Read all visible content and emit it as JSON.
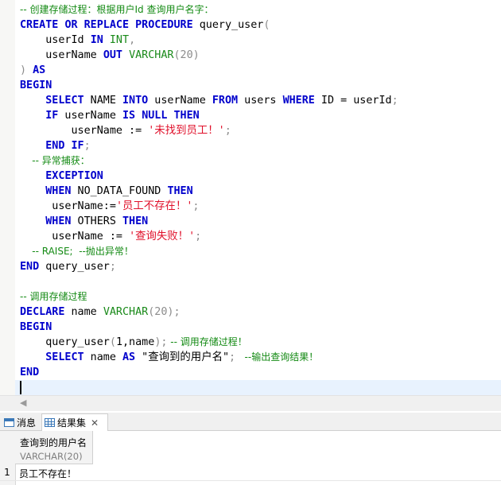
{
  "editor": {
    "lines": [
      [
        {
          "t": "-- 创建存储过程：根据用户Id 查询用户名字：",
          "c": "c"
        }
      ],
      [
        {
          "t": "CREATE",
          "c": "k"
        },
        {
          "t": " ",
          "c": "i"
        },
        {
          "t": "OR",
          "c": "k"
        },
        {
          "t": " ",
          "c": "i"
        },
        {
          "t": "REPLACE",
          "c": "k"
        },
        {
          "t": " ",
          "c": "i"
        },
        {
          "t": "PROCEDURE",
          "c": "k"
        },
        {
          "t": " query_user",
          "c": "i"
        },
        {
          "t": "(",
          "c": "p"
        }
      ],
      [
        {
          "t": "    userId ",
          "c": "i"
        },
        {
          "t": "IN",
          "c": "k"
        },
        {
          "t": " ",
          "c": "i"
        },
        {
          "t": "INT",
          "c": "t"
        },
        {
          "t": ",",
          "c": "p"
        }
      ],
      [
        {
          "t": "    userName ",
          "c": "i"
        },
        {
          "t": "OUT",
          "c": "k"
        },
        {
          "t": " ",
          "c": "i"
        },
        {
          "t": "VARCHAR",
          "c": "t"
        },
        {
          "t": "(20)",
          "c": "p"
        }
      ],
      [
        {
          "t": ")",
          "c": "p"
        },
        {
          "t": " ",
          "c": "i"
        },
        {
          "t": "AS",
          "c": "k"
        }
      ],
      [
        {
          "t": "BEGIN",
          "c": "k"
        }
      ],
      [
        {
          "t": "    ",
          "c": "i"
        },
        {
          "t": "SELECT",
          "c": "k"
        },
        {
          "t": " NAME ",
          "c": "i"
        },
        {
          "t": "INTO",
          "c": "k"
        },
        {
          "t": " userName ",
          "c": "i"
        },
        {
          "t": "FROM",
          "c": "k"
        },
        {
          "t": " users ",
          "c": "i"
        },
        {
          "t": "WHERE",
          "c": "k"
        },
        {
          "t": " ID = userId",
          "c": "i"
        },
        {
          "t": ";",
          "c": "p"
        }
      ],
      [
        {
          "t": "    ",
          "c": "i"
        },
        {
          "t": "IF",
          "c": "k"
        },
        {
          "t": " userName ",
          "c": "i"
        },
        {
          "t": "IS",
          "c": "k"
        },
        {
          "t": " ",
          "c": "i"
        },
        {
          "t": "NULL",
          "c": "k"
        },
        {
          "t": " ",
          "c": "i"
        },
        {
          "t": "THEN",
          "c": "k"
        }
      ],
      [
        {
          "t": "        userName := ",
          "c": "i"
        },
        {
          "t": "'未找到员工！'",
          "c": "s"
        },
        {
          "t": ";",
          "c": "p"
        }
      ],
      [
        {
          "t": "    ",
          "c": "i"
        },
        {
          "t": "END",
          "c": "k"
        },
        {
          "t": " ",
          "c": "i"
        },
        {
          "t": "IF",
          "c": "k"
        },
        {
          "t": ";",
          "c": "p"
        }
      ],
      [
        {
          "t": "    -- 异常捕获：",
          "c": "c"
        }
      ],
      [
        {
          "t": "    ",
          "c": "i"
        },
        {
          "t": "EXCEPTION",
          "c": "k"
        }
      ],
      [
        {
          "t": "    ",
          "c": "i"
        },
        {
          "t": "WHEN",
          "c": "k"
        },
        {
          "t": " NO_DATA_FOUND ",
          "c": "i"
        },
        {
          "t": "THEN",
          "c": "k"
        }
      ],
      [
        {
          "t": "     userName:=",
          "c": "i"
        },
        {
          "t": "'员工不存在！'",
          "c": "s"
        },
        {
          "t": ";",
          "c": "p"
        }
      ],
      [
        {
          "t": "    ",
          "c": "i"
        },
        {
          "t": "WHEN",
          "c": "k"
        },
        {
          "t": " OTHERS ",
          "c": "i"
        },
        {
          "t": "THEN",
          "c": "k"
        }
      ],
      [
        {
          "t": "     userName := ",
          "c": "i"
        },
        {
          "t": "'查询失败！'",
          "c": "s"
        },
        {
          "t": ";",
          "c": "p"
        }
      ],
      [
        {
          "t": "    -- RAISE;  --抛出异常！",
          "c": "c"
        }
      ],
      [
        {
          "t": "END",
          "c": "k"
        },
        {
          "t": " query_user",
          "c": "i"
        },
        {
          "t": ";",
          "c": "p"
        }
      ],
      [],
      [
        {
          "t": "-- 调用存储过程",
          "c": "c"
        }
      ],
      [
        {
          "t": "DECLARE",
          "c": "k"
        },
        {
          "t": " name ",
          "c": "i"
        },
        {
          "t": "VARCHAR",
          "c": "t"
        },
        {
          "t": "(20);",
          "c": "p"
        }
      ],
      [
        {
          "t": "BEGIN",
          "c": "k"
        }
      ],
      [
        {
          "t": "    query_user",
          "c": "i"
        },
        {
          "t": "(",
          "c": "p"
        },
        {
          "t": "1,name",
          "c": "i"
        },
        {
          "t": ");",
          "c": "p"
        },
        {
          "t": " -- 调用存储过程！",
          "c": "c"
        }
      ],
      [
        {
          "t": "    ",
          "c": "i"
        },
        {
          "t": "SELECT",
          "c": "k"
        },
        {
          "t": " name ",
          "c": "i"
        },
        {
          "t": "AS",
          "c": "k"
        },
        {
          "t": " \"查询到的用户名\"",
          "c": "i"
        },
        {
          "t": ";",
          "c": "p"
        },
        {
          "t": "   --输出查询结果！",
          "c": "c"
        }
      ],
      [
        {
          "t": "END",
          "c": "k"
        }
      ],
      []
    ]
  },
  "tabs": {
    "messages_label": "消息",
    "results_label": "结果集",
    "close_symbol": "✕"
  },
  "result": {
    "column_name": "查询到的用户名",
    "column_type": "VARCHAR(20)",
    "row_number": "1",
    "row_value": "员工不存在！"
  }
}
